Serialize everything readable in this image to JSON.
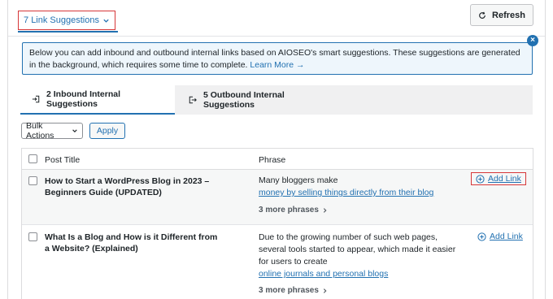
{
  "header": {
    "suggestions_tab": "7 Link Suggestions",
    "refresh_label": "Refresh"
  },
  "notice": {
    "text": "Below you can add inbound and outbound internal links based on AIOSEO's smart suggestions. These suggestions are generated in the background, which requires some time to complete.",
    "learn_more": "Learn More →"
  },
  "subtabs": {
    "inbound": "2 Inbound Internal Suggestions",
    "outbound": "5 Outbound Internal Suggestions"
  },
  "bulk": {
    "select_label": "Bulk Actions",
    "apply_label": "Apply"
  },
  "table": {
    "col_title": "Post Title",
    "col_phrase": "Phrase",
    "rows": [
      {
        "title": "How to Start a WordPress Blog in 2023 – Beginners Guide (UPDATED)",
        "phrase_text": "Many bloggers make",
        "phrase_link": "money by selling things directly from their blog",
        "more": "3 more phrases",
        "add_link": "Add Link"
      },
      {
        "title": "What Is a Blog and How is it Different from a Website? (Explained)",
        "phrase_text": "Due to the growing number of such web pages, several tools started to appear, which made it easier for users to create",
        "phrase_link": "online journals and personal blogs",
        "more": "3 more phrases",
        "add_link": "Add Link"
      }
    ]
  },
  "colors": {
    "accent": "#2271b1",
    "highlight": "#d63638"
  }
}
